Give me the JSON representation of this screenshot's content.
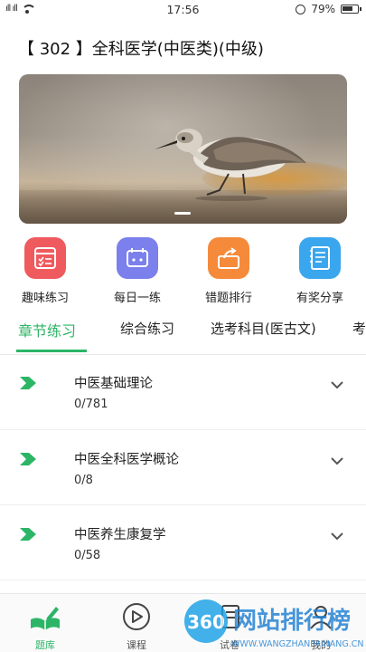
{
  "status_bar": {
    "signal": "ıll ıll",
    "time": "17:56",
    "battery": "79%",
    "battery_level": 0.79
  },
  "page": {
    "title": "【 302 】全科医学(中医类)(中级)"
  },
  "banner": {
    "slide_indicator_count": 1
  },
  "quick_actions": [
    {
      "label": "趣味练习",
      "icon": "checklist-icon",
      "color": "#ef5a5e"
    },
    {
      "label": "每日一练",
      "icon": "calendar-icon",
      "color": "#7b80ec"
    },
    {
      "label": "错题排行",
      "icon": "share-box-icon",
      "color": "#f58a3b"
    },
    {
      "label": "有奖分享",
      "icon": "notebook-icon",
      "color": "#3aa6ee"
    }
  ],
  "tabs": [
    {
      "label": "章节练习",
      "active": true
    },
    {
      "label": "综合练习",
      "active": false
    },
    {
      "label": "选考科目(医古文)",
      "active": false
    },
    {
      "label": "考",
      "active": false
    }
  ],
  "chapters": [
    {
      "name": "中医基础理论",
      "count": "0/781"
    },
    {
      "name": "中医全科医学概论",
      "count": "0/8"
    },
    {
      "name": "中医养生康复学",
      "count": "0/58"
    }
  ],
  "bottom_nav": [
    {
      "label": "题库",
      "icon": "book-pen-icon",
      "active": true
    },
    {
      "label": "课程",
      "icon": "play-circle-icon",
      "active": false
    },
    {
      "label": "试卷",
      "icon": "paper-icon",
      "active": false
    },
    {
      "label": "我的",
      "icon": "user-icon",
      "active": false
    }
  ],
  "watermark": {
    "badge": "360",
    "text": "网站排行榜",
    "url": "WWW.WANGZHANPAIHANG.CN"
  },
  "colors": {
    "accent": "#2cb566"
  }
}
